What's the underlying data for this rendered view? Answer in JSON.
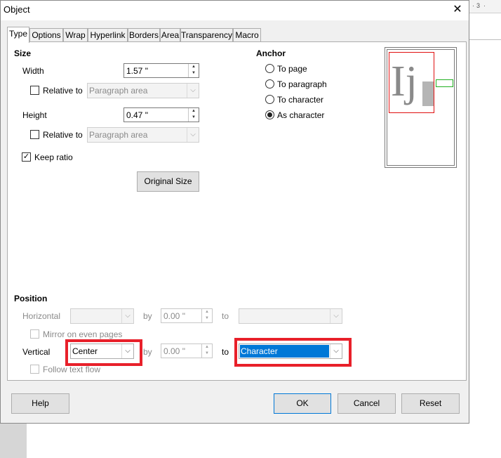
{
  "background": {
    "ruler_marks": [
      "·",
      "3",
      "·"
    ]
  },
  "window": {
    "title": "Object",
    "close_glyph": "✕"
  },
  "tabs": [
    {
      "label": "Type",
      "active": true
    },
    {
      "label": "Options"
    },
    {
      "label": "Wrap"
    },
    {
      "label": "Hyperlink"
    },
    {
      "label": "Borders"
    },
    {
      "label": "Area"
    },
    {
      "label": "Transparency"
    },
    {
      "label": "Macro"
    }
  ],
  "size": {
    "title": "Size",
    "width_label": "Width",
    "width_value": "1.57 \"",
    "width_relative_label": "Relative to",
    "width_relative_value": "Paragraph area",
    "height_label": "Height",
    "height_value": "0.47 \"",
    "height_relative_label": "Relative to",
    "height_relative_value": "Paragraph area",
    "keep_ratio_label": "Keep ratio",
    "keep_ratio_checked": true,
    "original_size_label": "Original Size"
  },
  "anchor": {
    "title": "Anchor",
    "options": [
      {
        "label": "To page",
        "checked": false
      },
      {
        "label": "To paragraph",
        "checked": false
      },
      {
        "label": "To character",
        "checked": false
      },
      {
        "label": "As character",
        "checked": true
      }
    ]
  },
  "preview": {
    "glyphs": "Ij"
  },
  "position": {
    "title": "Position",
    "horizontal_label": "Horizontal",
    "horizontal_value": "",
    "horizontal_by_label": "by",
    "horizontal_by_value": "0.00 \"",
    "horizontal_to_label": "to",
    "horizontal_to_value": "",
    "mirror_label": "Mirror on even pages",
    "vertical_label": "Vertical",
    "vertical_value": "Center",
    "vertical_by_label": "by",
    "vertical_by_value": "0.00 \"",
    "vertical_to_label": "to",
    "vertical_to_value": "Character",
    "follow_label": "Follow text flow"
  },
  "buttons": {
    "help": "Help",
    "ok": "OK",
    "cancel": "Cancel",
    "reset": "Reset"
  },
  "colors": {
    "highlight": "#e8202a",
    "selection": "#0078d7",
    "preview_frame": "#e01010",
    "preview_object": "#22b022"
  }
}
